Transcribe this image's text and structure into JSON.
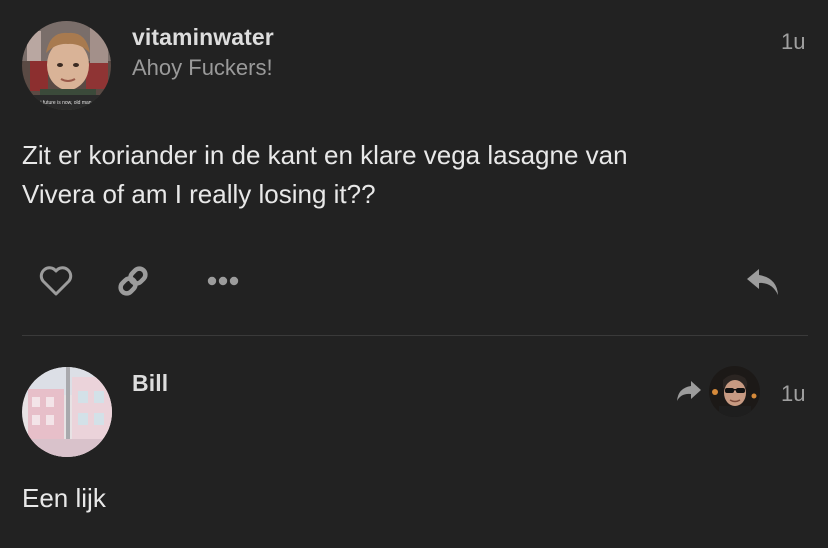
{
  "posts": [
    {
      "username": "vitaminwater",
      "title": "Ahoy Fuckers!",
      "time": "1u",
      "body_lines": [
        "Zit er koriander in de kant en klare vega lasagne van",
        "Vivera of am I really losing it??"
      ],
      "avatar_caption": "i future is now, old man"
    },
    {
      "username": "Bill",
      "time": "1u",
      "body_lines": [
        "Een lijk"
      ]
    }
  ],
  "actions": [
    "heart-icon",
    "link-icon",
    "more-icon",
    "reply-icon"
  ],
  "colors": {
    "background": "#222222",
    "username": "#dddddd",
    "subtitle": "#9a9a9a",
    "body": "#e8e8e8",
    "icon": "#9c9c9c",
    "divider": "#3a3a3a"
  }
}
